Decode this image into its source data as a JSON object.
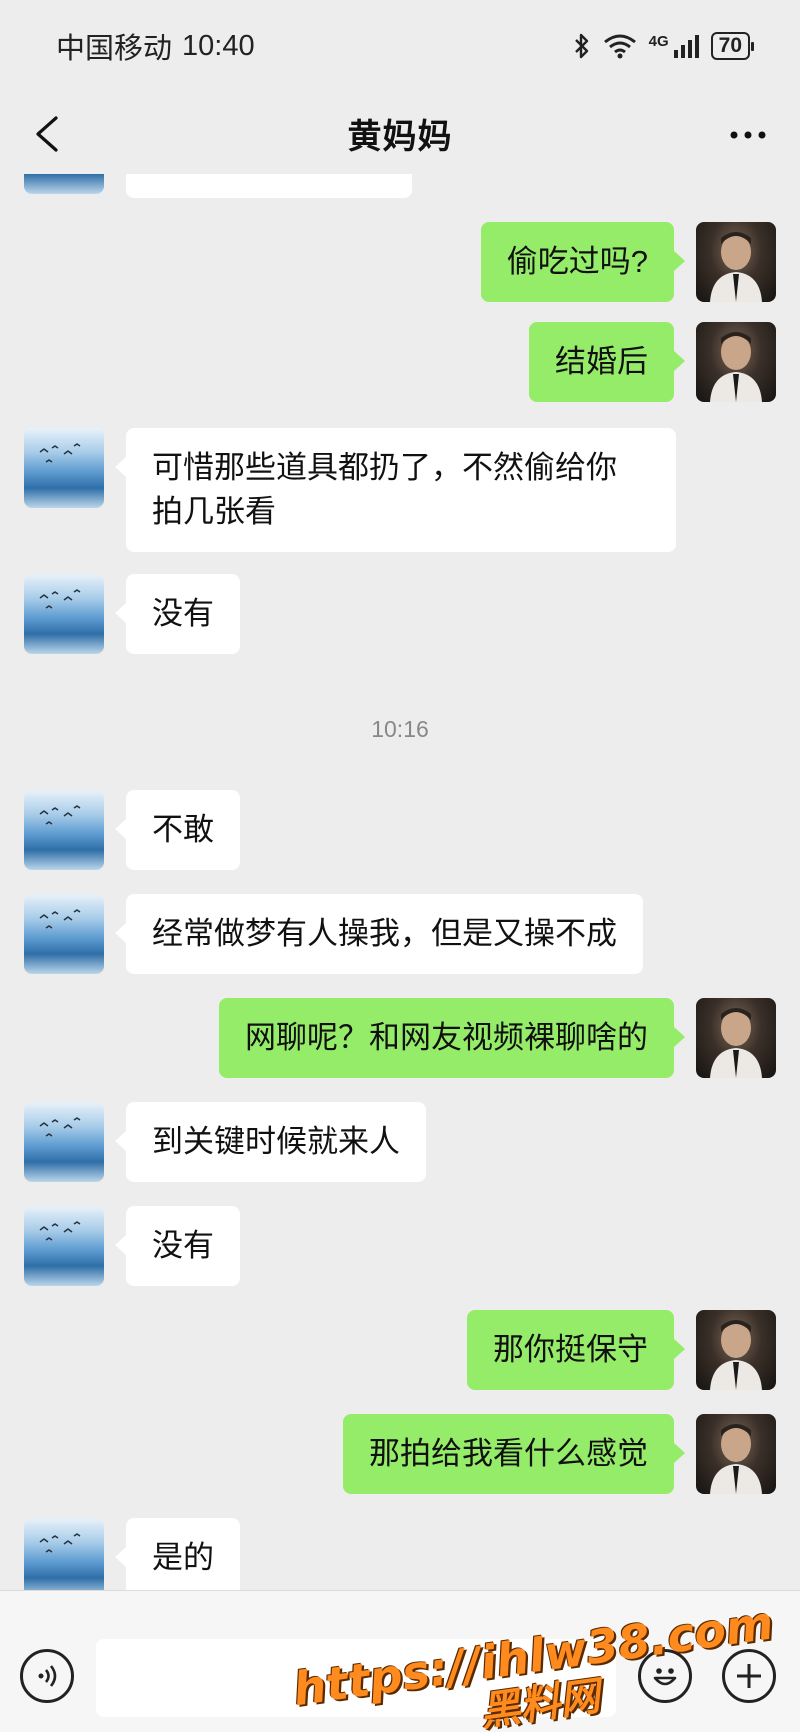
{
  "status_bar": {
    "carrier": "中国移动",
    "time": "10:40",
    "network": "4G",
    "battery": "70"
  },
  "header": {
    "title": "黄妈妈"
  },
  "messages": [
    {
      "side": "left",
      "text": "可惜那些道具都扔了，不然偷给你\n拍几张看"
    },
    {
      "side": "left",
      "text": "没有"
    },
    {
      "timestamp": "10:16"
    },
    {
      "side": "left",
      "text": "不敢"
    },
    {
      "side": "left",
      "text": "经常做梦有人操我，但是又操不成"
    },
    {
      "side": "right",
      "text": "网聊呢？和网友视频裸聊啥的"
    },
    {
      "side": "left",
      "text": "到关键时候就来人"
    },
    {
      "side": "left",
      "text": "没有"
    },
    {
      "side": "right",
      "text": "那你挺保守"
    },
    {
      "side": "right",
      "text": "那拍给我看什么感觉"
    },
    {
      "side": "left",
      "text": "是的"
    }
  ],
  "messages_top": [
    {
      "side": "right",
      "text": "偷吃过吗?"
    },
    {
      "side": "right",
      "text": "结婚后"
    }
  ],
  "watermark": {
    "line1": "https://ihlw38.com",
    "line2": "黑料网"
  },
  "colors": {
    "background": "#ededed",
    "sent_bubble": "#95ec69",
    "received_bubble": "#ffffff"
  }
}
